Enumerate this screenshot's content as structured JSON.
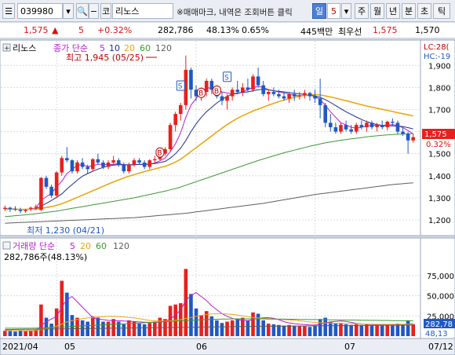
{
  "toolbar": {
    "code": "039980",
    "market_button": "코",
    "name": "리노스",
    "notice": "※매매마크, 내역은 조회버튼 클릭",
    "period_current": "일",
    "period_count": "5",
    "periods": [
      "주",
      "월",
      "년",
      "분",
      "초",
      "틱"
    ]
  },
  "info": {
    "price": "1,575",
    "change": "5",
    "change_rate": "+0.32%",
    "volume": "282,786",
    "volume_rate": "48.13%",
    "turnover": "0.65%",
    "amount": "445백만",
    "best_ask_label": "최우선",
    "best_ask": "1,575",
    "best_bid": "1,570"
  },
  "price_panel": {
    "title": "리노스",
    "legend": {
      "label": "종가 단순",
      "items": [
        "5",
        "10",
        "20",
        "60",
        "120"
      ]
    },
    "max_note": "최고 1,945 (05/25)",
    "min_note": "최저 1,230 (04/21)",
    "right_top": "LC:28(",
    "right_top2": "HC:-19",
    "price_tag": "1,575",
    "pct_tag": "0.32%",
    "y_ticks": [
      "1,900",
      "1,800",
      "1,700",
      "1,600",
      "1,500",
      "1,400",
      "1,300",
      "1,200"
    ],
    "marks": [
      {
        "i": 30,
        "t": "B"
      },
      {
        "i": 34,
        "t": "S"
      },
      {
        "i": 38,
        "t": "B"
      },
      {
        "i": 41,
        "t": "B"
      },
      {
        "i": 43,
        "t": "S"
      }
    ]
  },
  "volume_panel": {
    "legend": {
      "label": "거래량 단순",
      "items": [
        "5",
        "20",
        "60",
        "120"
      ]
    },
    "info": "282,786주(48.13%)",
    "y_ticks": [
      "75,000",
      "50,000",
      "25,000"
    ],
    "tag1": "282,78",
    "tag2": "48,13"
  },
  "x_axis": {
    "labels": [
      "2021/04",
      "05",
      "06",
      "07",
      "07/12"
    ]
  },
  "colors": {
    "up": "#e8201c",
    "down": "#1f58c6",
    "ma5": "#b71cd4",
    "ma10": "#1b2f8c",
    "ma20": "#e8a812",
    "ma60": "#3c9a32",
    "ma120": "#5e5e5e"
  },
  "chart_data": {
    "type": "candlestick",
    "ohlcv": [
      [
        1250,
        1265,
        1240,
        1255,
        40
      ],
      [
        1255,
        1260,
        1235,
        1250,
        38
      ],
      [
        1250,
        1262,
        1240,
        1248,
        35
      ],
      [
        1245,
        1255,
        1230,
        1240,
        45
      ],
      [
        1240,
        1250,
        1232,
        1245,
        36
      ],
      [
        1250,
        1260,
        1240,
        1255,
        40
      ],
      [
        1255,
        1270,
        1245,
        1260,
        48
      ],
      [
        1245,
        1395,
        1240,
        1390,
        240
      ],
      [
        1390,
        1400,
        1340,
        1350,
        140
      ],
      [
        1350,
        1360,
        1300,
        1310,
        95
      ],
      [
        1310,
        1420,
        1300,
        1415,
        210
      ],
      [
        1415,
        1490,
        1400,
        1480,
        420
      ],
      [
        1480,
        1530,
        1460,
        1470,
        330
      ],
      [
        1470,
        1475,
        1410,
        1420,
        160
      ],
      [
        1420,
        1470,
        1410,
        1460,
        140
      ],
      [
        1460,
        1480,
        1430,
        1440,
        120
      ],
      [
        1440,
        1450,
        1410,
        1430,
        110
      ],
      [
        1430,
        1480,
        1420,
        1475,
        150
      ],
      [
        1475,
        1500,
        1450,
        1460,
        140
      ],
      [
        1460,
        1470,
        1430,
        1440,
        110
      ],
      [
        1440,
        1470,
        1430,
        1460,
        110
      ],
      [
        1460,
        1490,
        1450,
        1470,
        130
      ],
      [
        1470,
        1480,
        1440,
        1450,
        110
      ],
      [
        1450,
        1460,
        1410,
        1420,
        90
      ],
      [
        1420,
        1460,
        1410,
        1450,
        120
      ],
      [
        1450,
        1480,
        1440,
        1470,
        110
      ],
      [
        1470,
        1480,
        1450,
        1460,
        95
      ],
      [
        1460,
        1470,
        1430,
        1440,
        90
      ],
      [
        1440,
        1475,
        1430,
        1470,
        100
      ],
      [
        1470,
        1490,
        1460,
        1475,
        110
      ],
      [
        1475,
        1510,
        1470,
        1500,
        140
      ],
      [
        1500,
        1530,
        1490,
        1520,
        130
      ],
      [
        1520,
        1640,
        1510,
        1630,
        230
      ],
      [
        1630,
        1690,
        1600,
        1680,
        240
      ],
      [
        1680,
        1730,
        1650,
        1720,
        250
      ],
      [
        1720,
        1945,
        1700,
        1880,
        510
      ],
      [
        1880,
        1890,
        1750,
        1790,
        320
      ],
      [
        1790,
        1810,
        1740,
        1760,
        210
      ],
      [
        1760,
        1800,
        1740,
        1780,
        160
      ],
      [
        1780,
        1840,
        1760,
        1830,
        190
      ],
      [
        1830,
        1840,
        1770,
        1790,
        150
      ],
      [
        1790,
        1810,
        1750,
        1760,
        120
      ],
      [
        1760,
        1780,
        1720,
        1740,
        100
      ],
      [
        1740,
        1770,
        1700,
        1760,
        110
      ],
      [
        1760,
        1800,
        1740,
        1790,
        120
      ],
      [
        1790,
        1830,
        1770,
        1780,
        130
      ],
      [
        1780,
        1820,
        1760,
        1800,
        140
      ],
      [
        1800,
        1840,
        1780,
        1790,
        120
      ],
      [
        1790,
        1860,
        1780,
        1850,
        180
      ],
      [
        1850,
        1890,
        1800,
        1810,
        170
      ],
      [
        1810,
        1830,
        1760,
        1770,
        120
      ],
      [
        1770,
        1790,
        1740,
        1780,
        95
      ],
      [
        1780,
        1800,
        1760,
        1770,
        90
      ],
      [
        1770,
        1790,
        1750,
        1760,
        85
      ],
      [
        1760,
        1780,
        1740,
        1750,
        80
      ],
      [
        1750,
        1775,
        1730,
        1770,
        85
      ],
      [
        1770,
        1790,
        1740,
        1760,
        80
      ],
      [
        1760,
        1780,
        1745,
        1765,
        78
      ],
      [
        1765,
        1790,
        1750,
        1775,
        75
      ],
      [
        1775,
        1780,
        1740,
        1760,
        70
      ],
      [
        1760,
        1790,
        1730,
        1750,
        80
      ],
      [
        1750,
        1840,
        1660,
        1720,
        130
      ],
      [
        1720,
        1730,
        1620,
        1640,
        140
      ],
      [
        1640,
        1680,
        1600,
        1620,
        110
      ],
      [
        1620,
        1640,
        1590,
        1600,
        95
      ],
      [
        1600,
        1640,
        1590,
        1630,
        100
      ],
      [
        1630,
        1650,
        1600,
        1610,
        90
      ],
      [
        1610,
        1630,
        1590,
        1600,
        85
      ],
      [
        1600,
        1640,
        1590,
        1630,
        90
      ],
      [
        1630,
        1650,
        1610,
        1620,
        85
      ],
      [
        1620,
        1650,
        1600,
        1640,
        90
      ],
      [
        1640,
        1650,
        1610,
        1620,
        80
      ],
      [
        1620,
        1640,
        1600,
        1630,
        85
      ],
      [
        1630,
        1650,
        1610,
        1620,
        80
      ],
      [
        1620,
        1650,
        1605,
        1645,
        85
      ],
      [
        1645,
        1660,
        1625,
        1640,
        80
      ],
      [
        1640,
        1650,
        1590,
        1600,
        95
      ],
      [
        1600,
        1620,
        1580,
        1590,
        90
      ],
      [
        1590,
        1600,
        1500,
        1560,
        120
      ],
      [
        1560,
        1590,
        1550,
        1575,
        90
      ]
    ],
    "ma": {
      "5": [
        1250,
        1249,
        1248,
        1247,
        1248,
        1249,
        1252,
        1290,
        1305,
        1320,
        1350,
        1375,
        1410,
        1428,
        1448,
        1450,
        1442,
        1445,
        1452,
        1452,
        1450,
        1452,
        1455,
        1450,
        1448,
        1450,
        1452,
        1452,
        1452,
        1458,
        1468,
        1480,
        1510,
        1545,
        1595,
        1665,
        1720,
        1750,
        1780,
        1800,
        1795,
        1790,
        1780,
        1775,
        1770,
        1772,
        1780,
        1790,
        1800,
        1805,
        1800,
        1790,
        1785,
        1780,
        1775,
        1770,
        1765,
        1762,
        1763,
        1765,
        1760,
        1745,
        1720,
        1690,
        1665,
        1640,
        1630,
        1620,
        1615,
        1620,
        1625,
        1628,
        1630,
        1628,
        1630,
        1632,
        1628,
        1618,
        1605,
        1590
      ],
      "10": [
        1250,
        1250,
        1249,
        1248,
        1248,
        1248,
        1249,
        1262,
        1275,
        1288,
        1302,
        1318,
        1340,
        1360,
        1380,
        1398,
        1410,
        1420,
        1430,
        1438,
        1444,
        1448,
        1450,
        1450,
        1450,
        1450,
        1451,
        1452,
        1453,
        1455,
        1460,
        1465,
        1480,
        1500,
        1525,
        1560,
        1600,
        1635,
        1665,
        1690,
        1710,
        1730,
        1745,
        1760,
        1770,
        1775,
        1778,
        1780,
        1785,
        1790,
        1792,
        1790,
        1785,
        1782,
        1780,
        1777,
        1774,
        1771,
        1768,
        1765,
        1762,
        1755,
        1745,
        1732,
        1718,
        1704,
        1690,
        1678,
        1666,
        1655,
        1645,
        1638,
        1632,
        1628,
        1626,
        1626,
        1625,
        1623,
        1618,
        1612
      ],
      "20": [
        1248,
        1248,
        1248,
        1248,
        1248,
        1248,
        1248,
        1252,
        1256,
        1260,
        1266,
        1273,
        1282,
        1292,
        1302,
        1312,
        1322,
        1332,
        1342,
        1352,
        1362,
        1372,
        1381,
        1390,
        1398,
        1405,
        1412,
        1419,
        1425,
        1431,
        1437,
        1443,
        1452,
        1462,
        1475,
        1492,
        1510,
        1527,
        1545,
        1562,
        1580,
        1598,
        1616,
        1632,
        1647,
        1660,
        1672,
        1683,
        1693,
        1702,
        1711,
        1720,
        1728,
        1736,
        1743,
        1749,
        1755,
        1760,
        1764,
        1768,
        1768,
        1766,
        1762,
        1757,
        1752,
        1746,
        1740,
        1734,
        1728,
        1722,
        1716,
        1711,
        1706,
        1701,
        1696,
        1691,
        1686,
        1681,
        1676,
        1671
      ],
      "60": [
        1215,
        1217,
        1219,
        1221,
        1223,
        1225,
        1228,
        1231,
        1234,
        1237,
        1240,
        1244,
        1248,
        1252,
        1256,
        1260,
        1264,
        1268,
        1272,
        1276,
        1280,
        1284,
        1288,
        1292,
        1296,
        1300,
        1305,
        1310,
        1315,
        1320,
        1325,
        1330,
        1336,
        1342,
        1349,
        1357,
        1365,
        1373,
        1381,
        1389,
        1397,
        1405,
        1413,
        1421,
        1429,
        1437,
        1445,
        1453,
        1461,
        1469,
        1476,
        1483,
        1490,
        1497,
        1504,
        1510,
        1516,
        1522,
        1528,
        1534,
        1539,
        1544,
        1549,
        1553,
        1557,
        1561,
        1564,
        1567,
        1570,
        1573,
        1576,
        1579,
        1581,
        1583,
        1585,
        1587,
        1588,
        1589,
        1590,
        1591
      ],
      "120": [
        1185,
        1186,
        1187,
        1188,
        1189,
        1190,
        1191,
        1192,
        1193,
        1194,
        1195,
        1196,
        1197,
        1198,
        1199,
        1200,
        1201,
        1202,
        1203,
        1204,
        1205,
        1206,
        1207,
        1208,
        1209,
        1210,
        1212,
        1214,
        1216,
        1218,
        1220,
        1222,
        1224,
        1226,
        1228,
        1230,
        1233,
        1236,
        1239,
        1242,
        1245,
        1248,
        1251,
        1254,
        1257,
        1260,
        1263,
        1266,
        1269,
        1272,
        1275,
        1279,
        1283,
        1287,
        1291,
        1295,
        1299,
        1303,
        1307,
        1311,
        1315,
        1318,
        1321,
        1324,
        1327,
        1330,
        1333,
        1336,
        1339,
        1342,
        1345,
        1348,
        1351,
        1354,
        1357,
        1360,
        1362,
        1364,
        1366,
        1368
      ]
    },
    "vol_ma5": [
      45,
      43,
      42,
      41,
      40,
      40,
      41,
      80,
      110,
      130,
      150,
      220,
      280,
      300,
      260,
      220,
      180,
      140,
      130,
      125,
      120,
      118,
      117,
      115,
      113,
      111,
      108,
      106,
      105,
      104,
      106,
      112,
      130,
      160,
      200,
      270,
      310,
      330,
      300,
      270,
      230,
      200,
      170,
      150,
      135,
      125,
      120,
      118,
      125,
      135,
      140,
      140,
      135,
      125,
      110,
      100,
      95,
      90,
      88,
      85,
      84,
      92,
      102,
      108,
      112,
      115,
      112,
      105,
      97,
      93,
      90,
      88,
      86,
      85,
      85,
      86,
      87,
      89,
      92,
      95
    ],
    "vol_ma20": [
      42,
      42,
      42,
      42,
      42,
      42,
      42,
      50,
      58,
      66,
      76,
      92,
      108,
      118,
      126,
      132,
      138,
      142,
      146,
      148,
      150,
      150,
      148,
      146,
      142,
      138,
      132,
      126,
      120,
      116,
      114,
      114,
      116,
      120,
      126,
      134,
      142,
      150,
      158,
      164,
      168,
      170,
      170,
      168,
      165,
      160,
      154,
      148,
      142,
      138,
      135,
      132,
      130,
      128,
      126,
      124,
      120,
      116,
      112,
      108,
      104,
      102,
      100,
      99,
      98,
      97,
      96,
      95,
      94,
      93,
      92,
      91,
      90,
      90,
      90,
      90,
      90,
      90,
      90,
      90
    ],
    "vol_ma60": [
      60,
      60,
      60,
      60,
      60,
      60,
      61,
      62,
      64,
      66,
      68,
      70,
      72,
      74,
      76,
      78,
      80,
      82,
      84,
      86,
      88,
      90,
      92,
      94,
      96,
      98,
      100,
      102,
      104,
      106,
      108,
      110,
      112,
      114,
      116,
      118,
      120,
      122,
      124,
      126,
      127,
      128,
      129,
      130,
      131,
      131,
      131,
      131,
      131,
      131,
      131,
      130,
      130,
      129,
      129,
      128,
      128,
      127,
      127,
      126,
      126,
      125,
      125,
      124,
      124,
      123,
      123,
      122,
      122,
      121,
      121,
      120,
      120,
      119,
      119,
      118,
      118,
      117,
      117,
      116
    ],
    "vol_ma120": [
      50,
      50,
      51,
      51,
      52,
      52,
      53,
      53,
      54,
      54,
      55,
      55,
      56,
      56,
      57,
      57,
      58,
      58,
      59,
      59,
      60,
      60,
      61,
      61,
      62,
      62,
      63,
      63,
      64,
      64,
      65,
      65,
      66,
      66,
      67,
      67,
      68,
      68,
      69,
      69,
      70,
      70,
      71,
      71,
      72,
      72,
      73,
      73,
      74,
      74,
      75,
      75,
      75,
      76,
      76,
      76,
      77,
      77,
      77,
      78,
      78,
      78,
      79,
      79,
      79,
      80,
      80,
      80,
      81,
      81,
      81,
      82,
      82,
      82,
      83,
      83,
      83,
      84,
      84,
      84
    ],
    "y_range": [
      1150,
      1990
    ],
    "vol_max": 560
  }
}
